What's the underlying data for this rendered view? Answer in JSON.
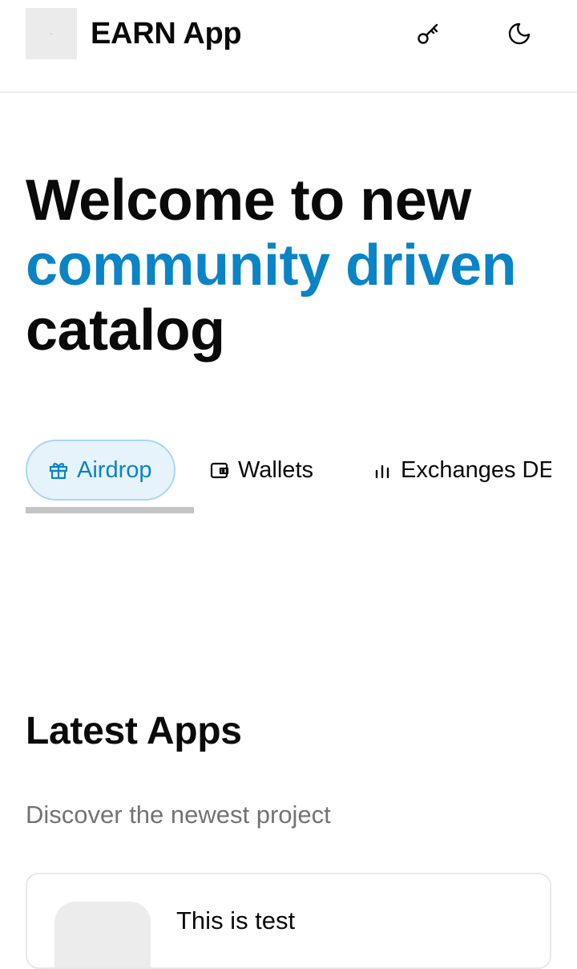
{
  "header": {
    "title": "EARN App",
    "icons": {
      "key": "key-icon",
      "theme": "moon-icon"
    }
  },
  "hero": {
    "line1": "Welcome to new",
    "line2": "community driven",
    "line3": "catalog",
    "accent_color": "#0a84c6"
  },
  "tabs": [
    {
      "label": "Airdrop",
      "icon": "gift-icon",
      "active": true
    },
    {
      "label": "Wallets",
      "icon": "wallet-icon",
      "active": false
    },
    {
      "label": "Exchanges DE",
      "icon": "bar-chart-icon",
      "active": false
    }
  ],
  "latest": {
    "title": "Latest Apps",
    "subtitle": "Discover the newest project",
    "cards": [
      {
        "title": "This is test"
      }
    ]
  }
}
